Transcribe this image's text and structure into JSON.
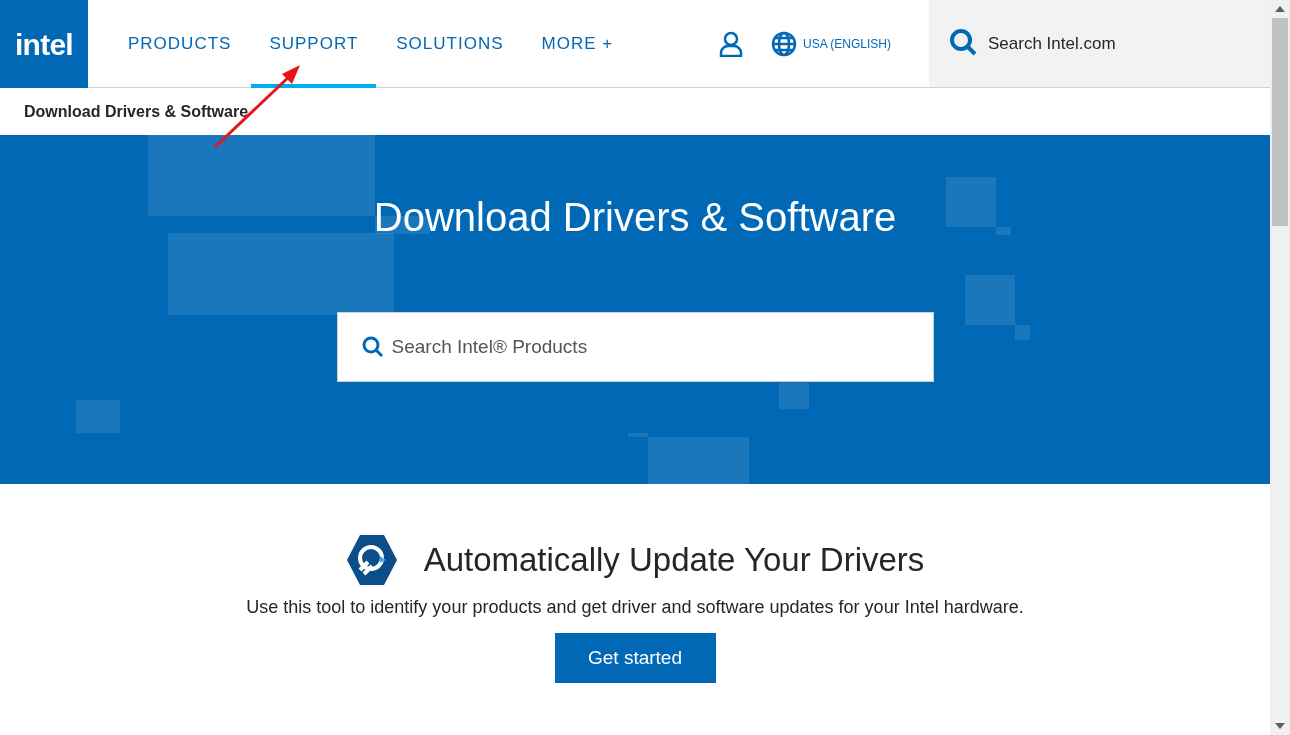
{
  "header": {
    "logo": "intel",
    "nav": [
      {
        "label": "PRODUCTS",
        "selected": false
      },
      {
        "label": "SUPPORT",
        "selected": true
      },
      {
        "label": "SOLUTIONS",
        "selected": false
      },
      {
        "label": "MORE +",
        "selected": false
      }
    ],
    "region": "USA (ENGLISH)",
    "search": {
      "placeholder": "Search Intel.com"
    }
  },
  "breadcrumb": "Download Drivers & Software",
  "hero": {
    "title": "Download Drivers & Software",
    "search": {
      "placeholder": "Search Intel® Products"
    }
  },
  "update": {
    "title": "Automatically Update Your Drivers",
    "description": "Use this tool to identify your products and get driver and software updates for your Intel hardware.",
    "button": "Get started"
  }
}
